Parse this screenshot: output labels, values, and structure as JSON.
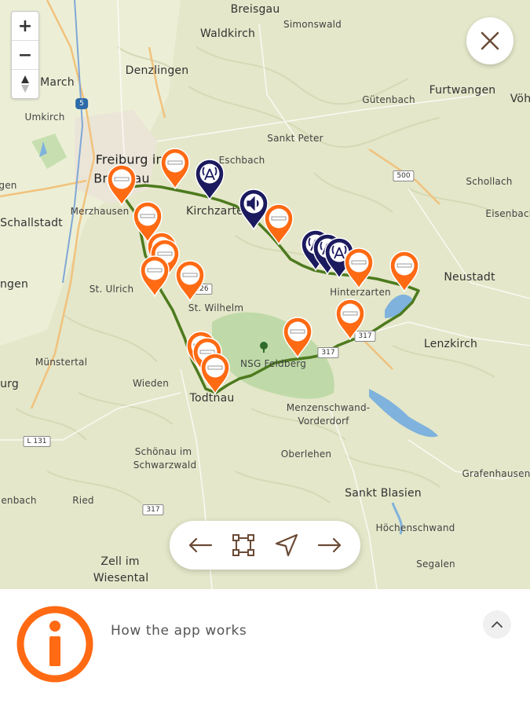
{
  "map": {
    "places": [
      {
        "name": "Breisgau",
        "key": "breisgau"
      },
      {
        "name": "Waldkirch",
        "key": "waldkirch"
      },
      {
        "name": "Simonswald",
        "key": "simonswald"
      },
      {
        "name": "March",
        "key": "march"
      },
      {
        "name": "Denzlingen",
        "key": "denzlingen"
      },
      {
        "name": "Furtwangen",
        "key": "furtwangen"
      },
      {
        "name": "Vöh",
        "key": "voeh"
      },
      {
        "name": "Gütenbach",
        "key": "guetenbach"
      },
      {
        "name": "Umkirch",
        "key": "umkirch"
      },
      {
        "name": "Sankt Peter",
        "key": "sanktpeter"
      },
      {
        "name": "Freiburg im",
        "key": "freiburg1"
      },
      {
        "name": "Breisgau",
        "key": "freiburg2"
      },
      {
        "name": "Eschbach",
        "key": "eschbach"
      },
      {
        "name": "gen",
        "key": "gen"
      },
      {
        "name": "Schollach",
        "key": "schollach"
      },
      {
        "name": "Merzhausen",
        "key": "merzhausen"
      },
      {
        "name": "Kirchzarten",
        "key": "kirchzarten"
      },
      {
        "name": "Schallstadt",
        "key": "schallstadt"
      },
      {
        "name": "Eisenbach",
        "key": "eisenbach"
      },
      {
        "name": "Neustadt",
        "key": "neustadt"
      },
      {
        "name": "ngen",
        "key": "ngen"
      },
      {
        "name": "St. Ulrich",
        "key": "stulrich"
      },
      {
        "name": "St. Wilhelm",
        "key": "stwilhelm"
      },
      {
        "name": "Hinterzarten",
        "key": "hinterzarten"
      },
      {
        "name": "Lenzkirch",
        "key": "lenzkirch"
      },
      {
        "name": "Münstertal",
        "key": "muenstertal"
      },
      {
        "name": "NSG Feldberg",
        "key": "feldberg"
      },
      {
        "name": "urg",
        "key": "urg"
      },
      {
        "name": "Wieden",
        "key": "wieden"
      },
      {
        "name": "Todtnau",
        "key": "todtnau"
      },
      {
        "name": "Menzenschwand-",
        "key": "menzen1"
      },
      {
        "name": "Vorderdorf",
        "key": "menzen2"
      },
      {
        "name": "Oberlehen",
        "key": "oberlehen"
      },
      {
        "name": "Schönau im",
        "key": "schoenau1"
      },
      {
        "name": "Schwarzwald",
        "key": "schoenau2"
      },
      {
        "name": "Grafenhausen",
        "key": "grafenhausen"
      },
      {
        "name": "enbach",
        "key": "enbach"
      },
      {
        "name": "Ried",
        "key": "ried"
      },
      {
        "name": "Sankt Blasien",
        "key": "sanktblasien"
      },
      {
        "name": "Höchenschwand",
        "key": "hoechenschwand"
      },
      {
        "name": "Zell im",
        "key": "zell1"
      },
      {
        "name": "Wiesental",
        "key": "zell2"
      },
      {
        "name": "Segalen",
        "key": "segalen"
      }
    ],
    "roads": [
      "5",
      "500",
      "317",
      "L 131",
      "317",
      "317",
      "126"
    ],
    "zoom": {
      "in": "+",
      "out": "−"
    },
    "colors": {
      "route": "#4d7a1e",
      "pin_orange": "#ff6a13",
      "pin_navy": "#1c1a5e",
      "water": "#7fb2dd",
      "forest": "#b9d7a2"
    }
  },
  "nav": {
    "prev": "prev-arrow",
    "fit": "fit-bounds",
    "locate": "locate",
    "next": "next-arrow"
  },
  "panel": {
    "title": "How the app works"
  }
}
